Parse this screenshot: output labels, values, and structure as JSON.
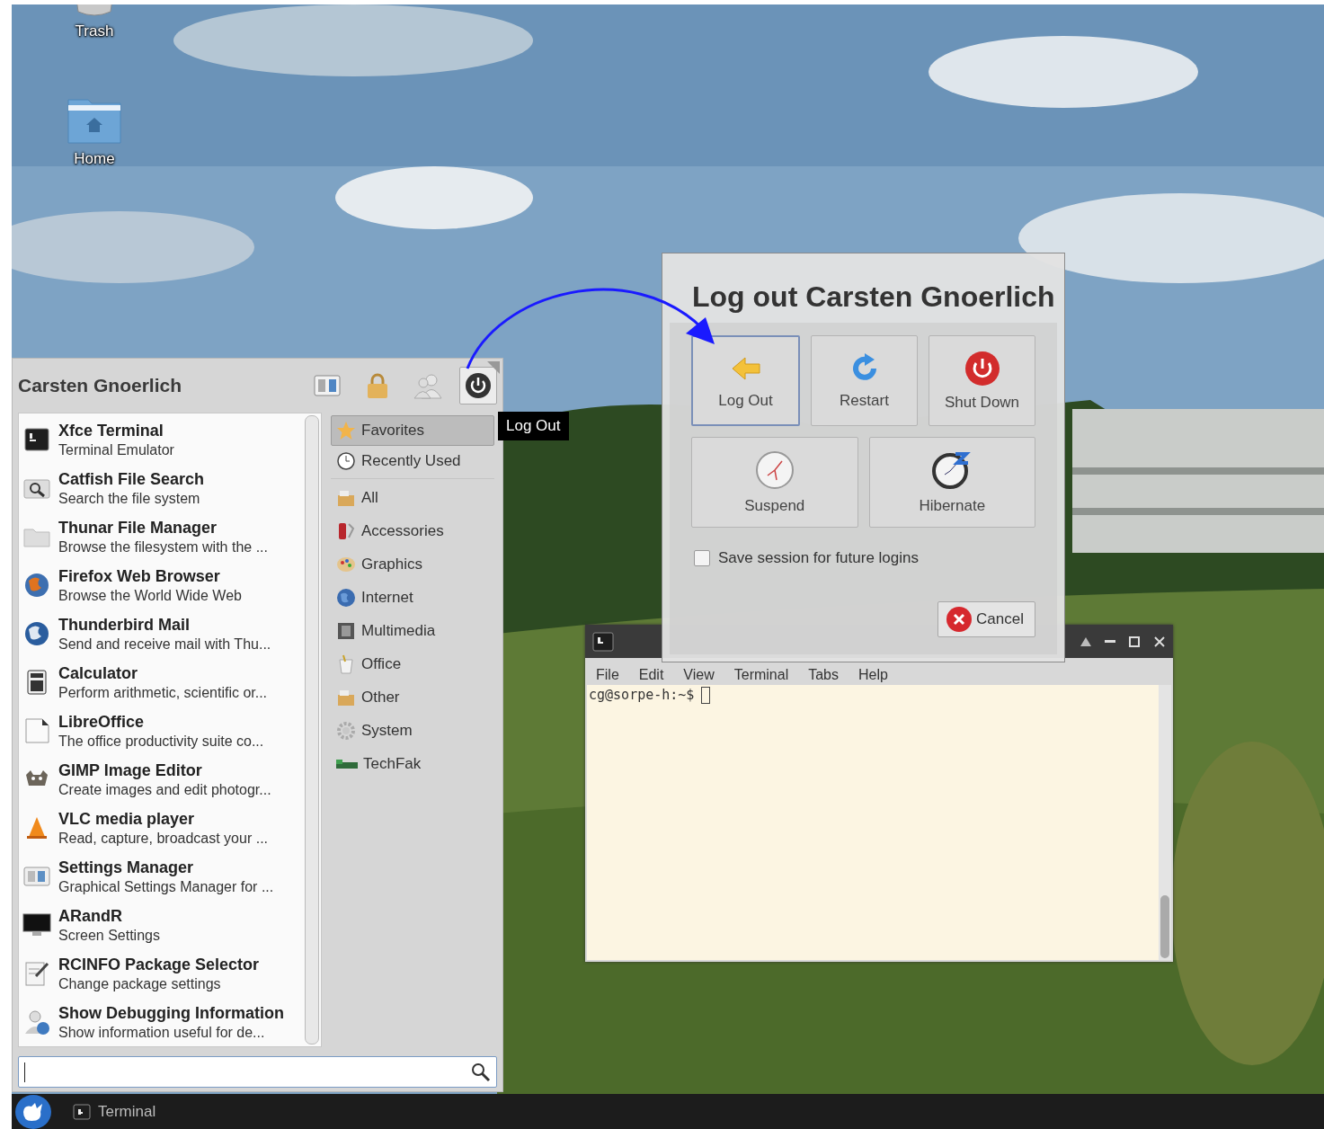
{
  "desktop_icons": [
    {
      "label": "Trash"
    },
    {
      "label": "Home"
    }
  ],
  "menu": {
    "user_name": "Carsten Gnoerlich",
    "actions": [
      {
        "selected": false
      },
      {
        "selected": false
      },
      {
        "selected": false
      },
      {
        "selected": true
      }
    ],
    "apps": [
      {
        "name": "Xfce Terminal",
        "description": "Terminal Emulator"
      },
      {
        "name": "Catfish File Search",
        "description": "Search the file system"
      },
      {
        "name": "Thunar File Manager",
        "description": "Browse the filesystem with the ..."
      },
      {
        "name": "Firefox Web Browser",
        "description": "Browse the World Wide Web"
      },
      {
        "name": "Thunderbird Mail",
        "description": "Send and receive mail with Thu..."
      },
      {
        "name": "Calculator",
        "description": "Perform arithmetic, scientific or..."
      },
      {
        "name": "LibreOffice",
        "description": "The office productivity suite co..."
      },
      {
        "name": "GIMP Image Editor",
        "description": "Create images and edit photogr..."
      },
      {
        "name": "VLC media player",
        "description": "Read, capture, broadcast your ..."
      },
      {
        "name": "Settings Manager",
        "description": "Graphical Settings Manager for ..."
      },
      {
        "name": "ARandR",
        "description": "Screen Settings"
      },
      {
        "name": "RCINFO Package Selector",
        "description": "Change package settings"
      },
      {
        "name": "Show Debugging Information",
        "description": "Show information useful for de..."
      }
    ],
    "categories": [
      {
        "label": "Favorites",
        "selected": true
      },
      {
        "label": "Recently Used",
        "selected": false
      },
      {
        "label": "All",
        "selected": false
      },
      {
        "label": "Accessories",
        "selected": false
      },
      {
        "label": "Graphics",
        "selected": false
      },
      {
        "label": "Internet",
        "selected": false
      },
      {
        "label": "Multimedia",
        "selected": false
      },
      {
        "label": "Office",
        "selected": false
      },
      {
        "label": "Other",
        "selected": false
      },
      {
        "label": "System",
        "selected": false
      },
      {
        "label": "TechFak",
        "selected": false
      }
    ]
  },
  "tooltip": {
    "text": "Log Out"
  },
  "terminal": {
    "menu": [
      "File",
      "Edit",
      "View",
      "Terminal",
      "Tabs",
      "Help"
    ],
    "prompt": "cg@sorpe-h:~$"
  },
  "dialog": {
    "title": "Log out Carsten Gnoerlich",
    "actions": [
      {
        "label": "Log Out",
        "selected": true
      },
      {
        "label": "Restart",
        "selected": false
      },
      {
        "label": "Shut Down",
        "selected": false
      },
      {
        "label": "Suspend",
        "selected": false
      },
      {
        "label": "Hibernate",
        "selected": false
      }
    ],
    "save_session": {
      "label": "Save session for future logins",
      "checked": false
    },
    "cancel": "Cancel"
  },
  "taskbar": {
    "tasks": [
      {
        "label": "Terminal"
      }
    ]
  }
}
